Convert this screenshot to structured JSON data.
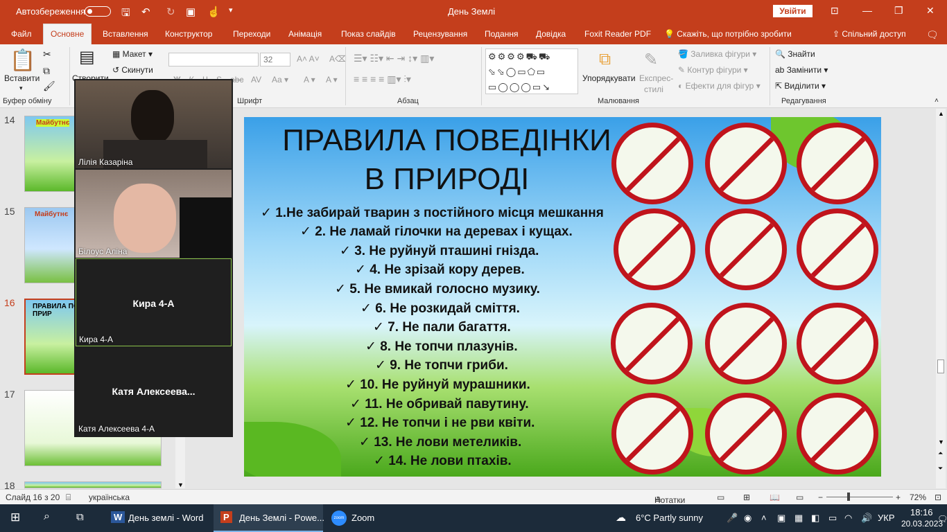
{
  "titlebar": {
    "autosave": "Автозбереження",
    "title": "День Землі",
    "signin": "Увійти"
  },
  "tabs": [
    "Файл",
    "Основне",
    "Вставлення",
    "Конструктор",
    "Переходи",
    "Анімація",
    "Показ слайдів",
    "Рецензування",
    "Подання",
    "Довідка",
    "Foxit Reader PDF",
    "Скажіть, що потрібно зробити",
    "Спільний доступ"
  ],
  "ribbon": {
    "paste": "Вставити",
    "create": "Створити",
    "layout": "Макет",
    "reset": "Скинути",
    "font_size": "32",
    "arrange": "Упорядкувати",
    "styles": "Експрес-",
    "styles2": "стилі",
    "fill": "Заливка фігури",
    "outline": "Контур фігури",
    "effects": "Ефекти для фігур",
    "find": "Знайти",
    "replace": "Замінити",
    "select": "Виділити",
    "groups": {
      "clipboard": "Буфер обміну",
      "font": "Шрифт",
      "paragraph": "Абзац",
      "drawing": "Малювання",
      "editing": "Редагування"
    }
  },
  "thumbs": [
    {
      "num": "14",
      "title": "Майбутнє"
    },
    {
      "num": "15",
      "title": "Майбутнє"
    },
    {
      "num": "16",
      "title": "ПРАВИЛА ПО В ПРИР"
    },
    {
      "num": "17",
      "title": ""
    },
    {
      "num": "18",
      "title": ""
    }
  ],
  "slide": {
    "title1": "ПРАВИЛА ПОВЕДІНКИ",
    "title2": "В ПРИРОДІ",
    "rules": [
      "1.Не забирай тварин з постійного місця мешкання",
      "2. Не ламай гілочки на деревах і кущах.",
      "3. Не руйнуй пташині гнізда.",
      "4. Не зрізай кору дерев.",
      "5. Не вмикай голосно музику.",
      "6. Не розкидай сміття.",
      "7. Не пали багаття.",
      "8. Не топчи плазунів.",
      "9. Не топчи гриби.",
      "10. Не руйнуй мурашники.",
      "11. Не обривай павутину.",
      "12. Не топчи і не рви квіти.",
      "13. Не лови метеликів.",
      "14. Не лови птахів."
    ]
  },
  "zoom": [
    {
      "name": "Лілія Казаріна",
      "center": ""
    },
    {
      "name": "Білоус Аліна",
      "center": ""
    },
    {
      "name": "Кира 4-А",
      "center": "Кира 4-А"
    },
    {
      "name": "Катя Алексеева 4-А",
      "center": "Катя  Алексеева..."
    }
  ],
  "status": {
    "slide": "Слайд 16 з 20",
    "lang": "українська",
    "notes": "Нотатки",
    "zoom": "72%"
  },
  "taskbar": {
    "word": "День землі - Word",
    "ppt": "День Землі - Powe...",
    "zoom": "Zoom",
    "weather": "6°C  Partly sunny",
    "lang": "УКР",
    "time": "18:16",
    "date": "20.03.2023"
  },
  "colors": {
    "accent": "#c43e1c",
    "taskbar": "#1c2b3a",
    "sign_red": "#c0141c"
  }
}
